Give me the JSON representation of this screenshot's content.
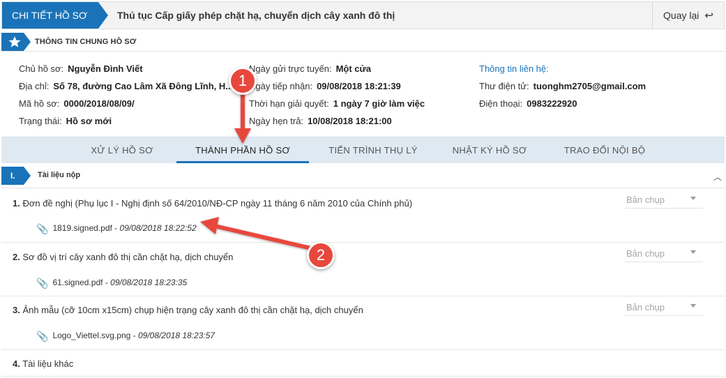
{
  "header": {
    "tag": "CHI TIẾT HỒ SƠ",
    "title": "Thủ tục Cấp giấy phép chặt hạ, chuyển dịch cây xanh đô thị",
    "back_label": "Quay lại",
    "tag_color": "#1a73b8"
  },
  "general": {
    "title": "THÔNG TIN CHUNG HỒ SƠ",
    "owner_label": "Chủ hồ sơ:",
    "owner_value": "Nguyễn Đình Viết",
    "address_label": "Địa chỉ:",
    "address_value": "Số 78, đường Cao Lâm Xã Đông Lĩnh, H...",
    "code_label": "Mã hồ sơ:",
    "code_value": "0000/2018/08/09/",
    "status_label": "Trạng thái:",
    "status_value": "Hồ sơ mới",
    "submit_online_label": "Ngày gửi trực tuyến:",
    "submit_online_value": "Một cửa",
    "receive_label": "Ngày tiếp nhận:",
    "receive_value": "09/08/2018 18:21:39",
    "deadline_label": "Thời hạn giải quyết:",
    "deadline_value": "1 ngày 7 giờ làm việc",
    "appointment_label": "Ngày hẹn trả:",
    "appointment_value": "10/08/2018 18:21:00",
    "contact_title": "Thông tin liên hệ:",
    "email_label": "Thư điện tử:",
    "email_value": "tuonghm2705@gmail.com",
    "phone_label": "Điện thoại:",
    "phone_value": "0983222920"
  },
  "tabs": [
    {
      "label": "XỬ LÝ HỒ SƠ",
      "active": false
    },
    {
      "label": "THÀNH PHẦN HỒ SƠ",
      "active": true
    },
    {
      "label": "TIẾN TRÌNH THỤ LÝ",
      "active": false
    },
    {
      "label": "NHẬT KÝ HỒ SƠ",
      "active": false
    },
    {
      "label": "TRAO ĐỔI NỘI BỘ",
      "active": false
    }
  ],
  "section_i": {
    "number": "I.",
    "title": "Tài liệu nộp"
  },
  "documents": [
    {
      "index": "1.",
      "title": "Đơn đề nghị (Phụ lục I - Nghị định số 64/2010/NĐ-CP ngày 11 tháng 6 năm 2010 của Chính phủ)",
      "select": "Bản chụp",
      "file": "1819.signed.pdf",
      "date": "09/08/2018 18:22:52"
    },
    {
      "index": "2.",
      "title": "Sơ đồ vị trí cây xanh đô thị cần chặt hạ, dịch chuyển",
      "select": "Bản chụp",
      "file": "61.signed.pdf",
      "date": "09/08/2018 18:23:35"
    },
    {
      "index": "3.",
      "title": "Ảnh mẫu (cỡ 10cm x15cm) chụp hiện trạng cây xanh đô thị cần chặt hạ, dịch chuyển",
      "select": "Bản chụp",
      "file": "Logo_Viettel.svg.png",
      "date": "09/08/2018 18:23:57"
    },
    {
      "index": "4.",
      "title": "Tài liệu khác"
    }
  ],
  "annotations": {
    "marker_1": "1",
    "marker_2": "2",
    "color": "#e8473d"
  },
  "icons": {
    "back": "undo-arrow-icon",
    "section": "star-icon",
    "attachment": "paperclip-icon",
    "collapse": "chevron-up-icon"
  }
}
